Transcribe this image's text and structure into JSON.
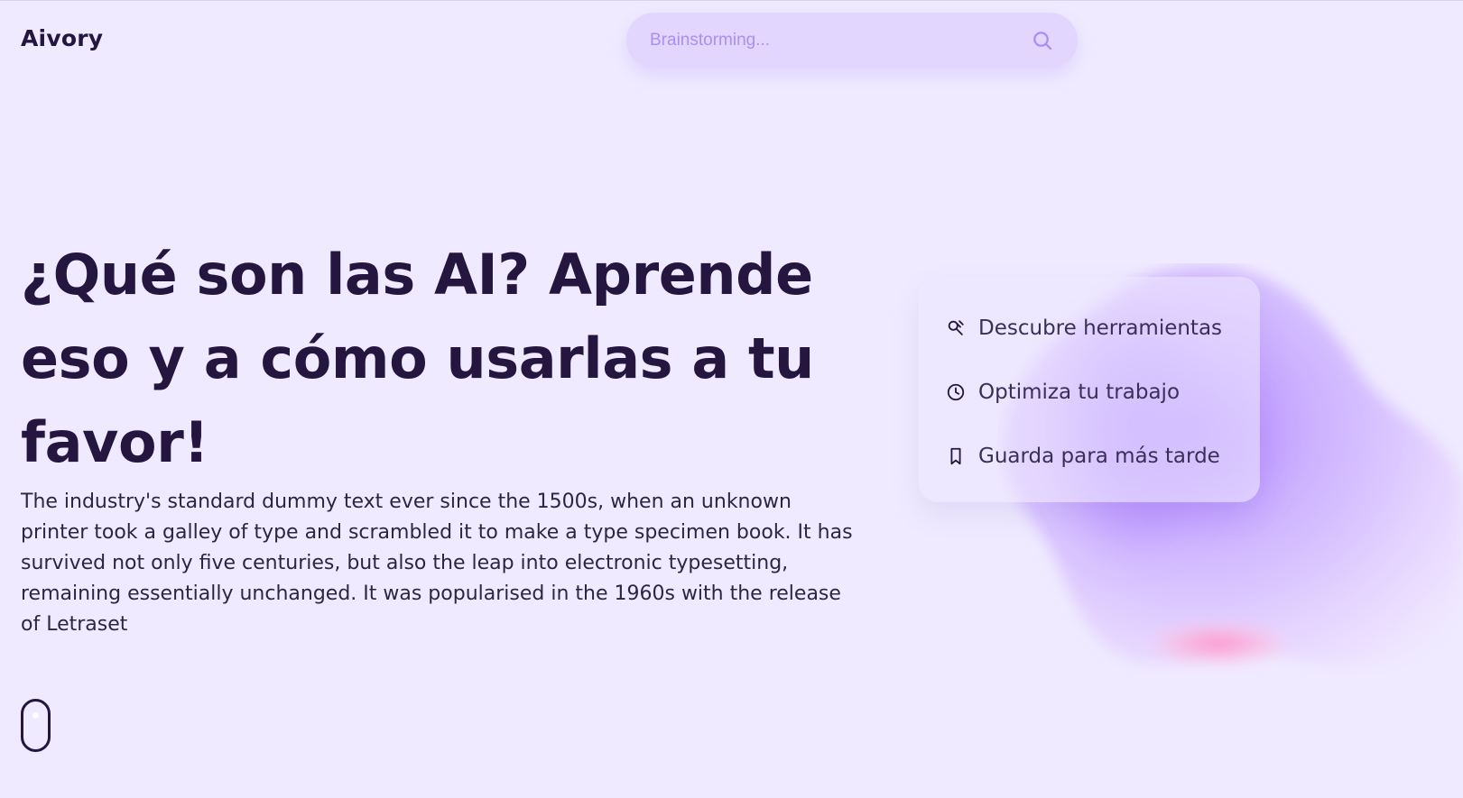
{
  "header": {
    "brand": "Aivory",
    "search": {
      "placeholder": "Brainstorming...",
      "value": "",
      "icon": "search-icon"
    }
  },
  "hero": {
    "title": "¿Qué son las AI? Aprende eso y a cómo usarlas a tu favor!",
    "description": "The industry's standard dummy text ever since the 1500s, when an unknown printer took a galley of type and scrambled it to make a type specimen book. It has survived not only five centuries, but also the leap into electronic typesetting, remaining essentially unchanged. It was popularised in the 1960s with the release of Letraset"
  },
  "features": [
    {
      "label": "Descubre herramientas",
      "icon": "wrench-search-icon"
    },
    {
      "label": "Optimiza tu trabajo",
      "icon": "clock-icon"
    },
    {
      "label": "Guarda para más tarde",
      "icon": "bookmark-icon"
    }
  ],
  "colors": {
    "background": "#efeaff",
    "text_dark": "#24163f",
    "search_bg": "#e2d6ff",
    "accent_purple": "#a889f8",
    "accent_pink": "#ff8fc7"
  }
}
